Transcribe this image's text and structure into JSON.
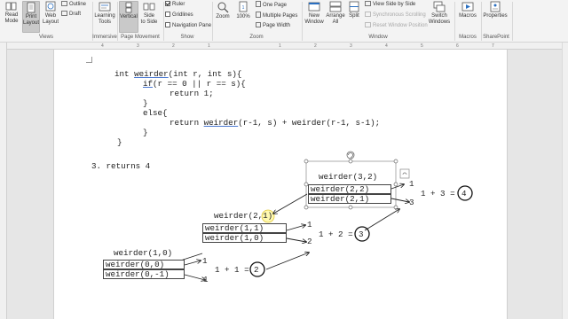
{
  "ribbon": {
    "views": {
      "read_mode": "Read\nMode",
      "print_layout": "Print\nLayout",
      "web_layout": "Web\nLayout",
      "outline": "Outline",
      "draft": "Draft",
      "group_label": "Views"
    },
    "immersive": {
      "learning_tools": "Learning\nTools",
      "group_label": "Immersive"
    },
    "page_movement": {
      "vertical": "Vertical",
      "side_to_side": "Side\nto Side",
      "group_label": "Page Movement"
    },
    "show": {
      "ruler": "Ruler",
      "gridlines": "Gridlines",
      "navigation_pane": "Navigation Pane",
      "group_label": "Show",
      "ruler_checked": true,
      "gridlines_checked": false,
      "navigation_checked": false
    },
    "zoom": {
      "zoom": "Zoom",
      "hundred": "100%",
      "one_page": "One Page",
      "multiple_pages": "Multiple Pages",
      "page_width": "Page Width",
      "group_label": "Zoom"
    },
    "window": {
      "new_window": "New\nWindow",
      "arrange_all": "Arrange\nAll",
      "split": "Split",
      "view_side_by_side": "View Side by Side",
      "synchronous_scrolling": "Synchronous Scrolling",
      "reset_window_position": "Reset Window Position",
      "switch_windows": "Switch\nWindows",
      "group_label": "Window"
    },
    "macros": {
      "macros": "Macros",
      "group_label": "Macros"
    },
    "sharepoint": {
      "properties": "Properties",
      "group_label": "SharePoint"
    }
  },
  "ruler_numbers": [
    "4",
    "3",
    "2",
    "1",
    "1",
    "2",
    "3",
    "4",
    "5",
    "6",
    "7"
  ],
  "code": {
    "l1a": "int ",
    "l1b": "weirder",
    "l1c": "(int r, int s){",
    "l2a": "if",
    "l2b": "(r == 0 || r == s){",
    "l3": "return 1;",
    "l4": "}",
    "l5": "else{",
    "l6a": "return ",
    "l6b": "weirder",
    "l6c": "(r-1, s) + weirder(r-1, s-1);",
    "l7": "}",
    "l8": "}"
  },
  "answer": "3. returns 4",
  "tree": {
    "n32": {
      "title": "weirder(3,2)",
      "c1": "weirder(2,2)",
      "c2": "weirder(2,1)",
      "r1": "1",
      "r2": "3",
      "sum": "1 + 3 =",
      "res": "4"
    },
    "n21": {
      "title": "weirder(2,1)",
      "c1": "weirder(1,1)",
      "c2": "weirder(1,0)",
      "r1": "1",
      "r2": "2",
      "sum": "1 + 2 =",
      "res": "3"
    },
    "n10": {
      "title": "weirder(1,0)",
      "c1": "weirder(0,0)",
      "c2": "weirder(0,-1)",
      "r1": "1",
      "r2": "1",
      "sum": "1 + 1 =",
      "res": "2"
    }
  }
}
